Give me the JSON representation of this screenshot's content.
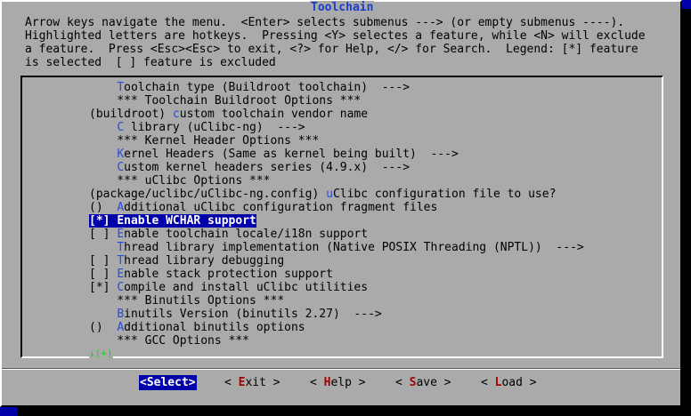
{
  "dialog": {
    "title": "Toolchain"
  },
  "help_lines": [
    "Arrow keys navigate the menu.  <Enter> selects submenus ---> (or empty submenus ----).",
    "Highlighted letters are hotkeys.  Pressing <Y> selectes a feature, while <N> will exclude",
    "a feature.  Press <Esc><Esc> to exit, <?> for Help, </> for Search.  Legend: [*] feature",
    "is selected  [ ] feature is excluded"
  ],
  "menu": {
    "items": [
      {
        "pre": "    ",
        "hk": "T",
        "rest": "oolchain type (Buildroot toolchain)  --->"
      },
      {
        "pre": "    *** Toolchain Buildroot Options ***",
        "hk": "",
        "rest": ""
      },
      {
        "pre": "(buildroot) ",
        "hk": "c",
        "rest": "ustom toolchain vendor name"
      },
      {
        "pre": "    ",
        "hk": "C",
        "rest": " library (uClibc-ng)  --->"
      },
      {
        "pre": "    *** Kernel Header Options ***",
        "hk": "",
        "rest": ""
      },
      {
        "pre": "    ",
        "hk": "K",
        "rest": "ernel Headers (Same as kernel being built)  --->"
      },
      {
        "pre": "    ",
        "hk": "C",
        "rest": "ustom kernel headers series (4.9.x)  --->"
      },
      {
        "pre": "    *** uClibc Options ***",
        "hk": "",
        "rest": ""
      },
      {
        "pre": "(package/uclibc/uClibc-ng.config) ",
        "hk": "u",
        "rest": "Clibc configuration file to use?"
      },
      {
        "pre": "()  ",
        "hk": "A",
        "rest": "dditional uClibc configuration fragment files"
      },
      {
        "pre": "[*] ",
        "hk": "E",
        "rest": "nable WCHAR support"
      },
      {
        "pre": "[ ] ",
        "hk": "E",
        "rest": "nable toolchain locale/i18n support"
      },
      {
        "pre": "    ",
        "hk": "T",
        "rest": "hread library implementation (Native POSIX Threading (NPTL))  --->"
      },
      {
        "pre": "[ ] ",
        "hk": "T",
        "rest": "hread library debugging"
      },
      {
        "pre": "[ ] ",
        "hk": "E",
        "rest": "nable stack protection support"
      },
      {
        "pre": "[*] ",
        "hk": "C",
        "rest": "ompile and install uClibc utilities"
      },
      {
        "pre": "    *** Binutils Options ***",
        "hk": "",
        "rest": ""
      },
      {
        "pre": "    ",
        "hk": "B",
        "rest": "inutils Version (binutils 2.27)  --->"
      },
      {
        "pre": "()  ",
        "hk": "A",
        "rest": "dditional binutils options"
      },
      {
        "pre": "    *** GCC Options ***",
        "hk": "",
        "rest": ""
      }
    ],
    "selected_index": 10,
    "more_indicator": "↓(+)"
  },
  "buttons": [
    {
      "pre": "<",
      "hk": "S",
      "rest": "elect>",
      "active": true
    },
    {
      "pre": "< ",
      "hk": "E",
      "rest": "xit >",
      "active": false
    },
    {
      "pre": "< ",
      "hk": "H",
      "rest": "elp >",
      "active": false
    },
    {
      "pre": "< ",
      "hk": "S",
      "rest": "ave >",
      "active": false
    },
    {
      "pre": "< ",
      "hk": "L",
      "rest": "oad >",
      "active": false
    }
  ],
  "colors": {
    "screen_bg": "#0000aa",
    "dialog_bg": "#aaaaaa",
    "title": "#1a3cc8",
    "hotkey": "#2a4ad8",
    "button_hotkey": "#aa0000",
    "selection_bg": "#0000aa",
    "more_indicator": "#22cc22"
  }
}
